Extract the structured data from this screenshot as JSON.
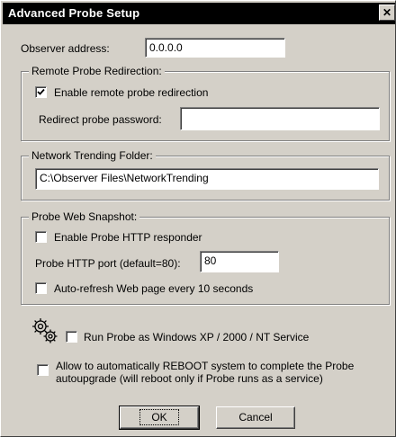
{
  "window": {
    "title": "Advanced Probe Setup",
    "close_symbol": "✕"
  },
  "observer": {
    "label": "Observer address:",
    "value": "0.0.0.0"
  },
  "redirection": {
    "group_title": "Remote Probe Redirection:",
    "enable_label": "Enable remote probe redirection",
    "enable_checked": true,
    "password_label": "Redirect probe password:",
    "password_value": ""
  },
  "trending": {
    "group_title": "Network Trending Folder:",
    "path_value": "C:\\Observer Files\\NetworkTrending"
  },
  "snapshot": {
    "group_title": "Probe Web Snapshot:",
    "http_label": "Enable Probe HTTP responder",
    "http_checked": false,
    "port_label": "Probe HTTP port (default=80):",
    "port_value": "80",
    "refresh_label": "Auto-refresh Web page every 10 seconds",
    "refresh_checked": false
  },
  "service": {
    "icon": "gears-icon",
    "label": "Run Probe as Windows XP / 2000 / NT  Service",
    "checked": false
  },
  "reboot": {
    "line1": "Allow to automatically REBOOT system to complete the Probe",
    "line2": "autoupgrade (will reboot only if Probe runs as a service)",
    "checked": false
  },
  "buttons": {
    "ok": "OK",
    "cancel": "Cancel"
  }
}
